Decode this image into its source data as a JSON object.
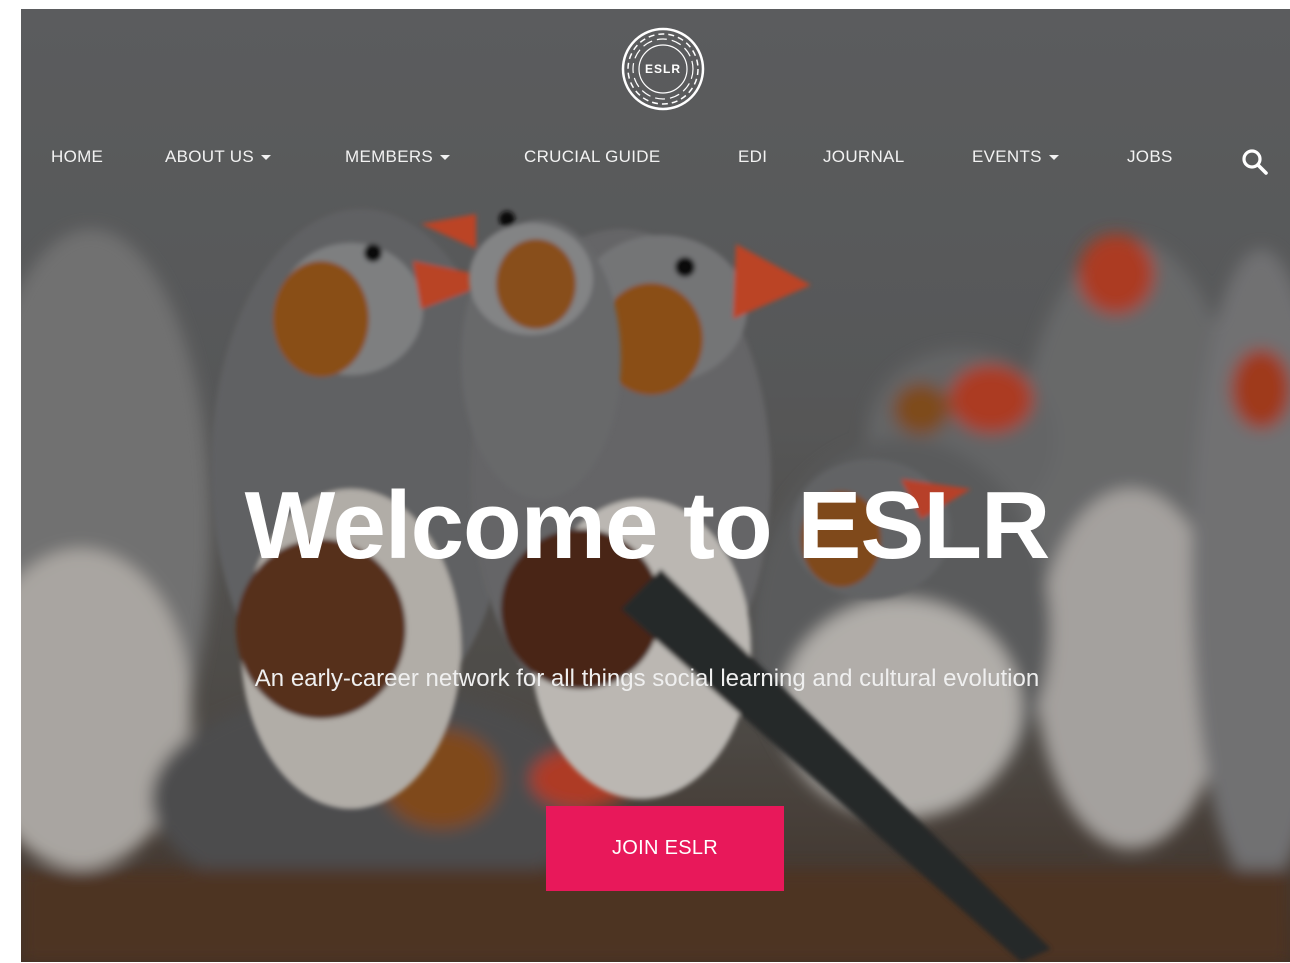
{
  "site": {
    "logo_text": "ESLR"
  },
  "nav": {
    "items": [
      {
        "label": "HOME",
        "dropdown": false
      },
      {
        "label": "ABOUT US",
        "dropdown": true
      },
      {
        "label": "MEMBERS",
        "dropdown": true
      },
      {
        "label": "CRUCIAL GUIDE",
        "dropdown": false
      },
      {
        "label": "EDI",
        "dropdown": false
      },
      {
        "label": "JOURNAL",
        "dropdown": false
      },
      {
        "label": "EVENTS",
        "dropdown": true
      },
      {
        "label": "JOBS",
        "dropdown": false
      }
    ],
    "search_icon": "search-icon"
  },
  "hero": {
    "title": "Welcome to ESLR",
    "subtitle": "An early-career network for all things social learning and cultural evolution",
    "cta_label": "JOIN ESLR",
    "background": "photo of zebra finches"
  },
  "colors": {
    "accent": "#e8185a",
    "nav_text": "#f2f2f2",
    "title_text": "#ffffff"
  }
}
